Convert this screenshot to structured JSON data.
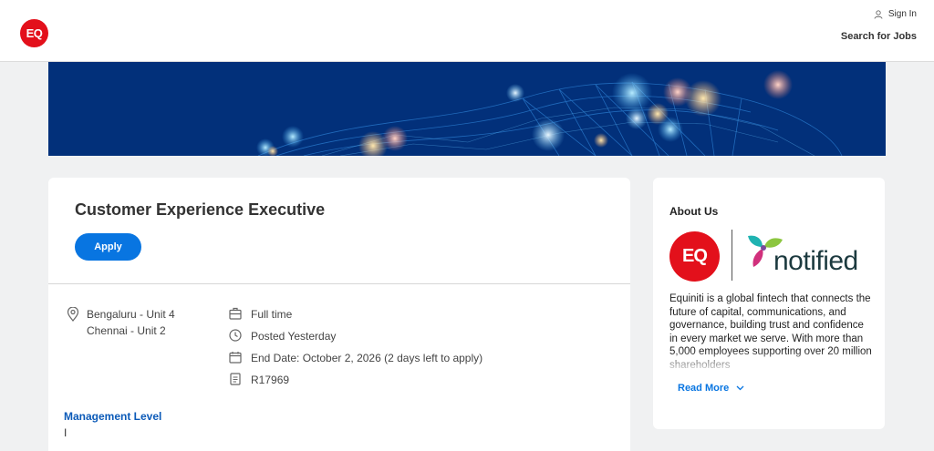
{
  "header": {
    "logo_text": "EQ",
    "sign_in": "Sign In",
    "search_jobs": "Search for Jobs"
  },
  "job": {
    "title": "Customer Experience Executive",
    "apply_label": "Apply",
    "locations": [
      "Bengaluru - Unit 4",
      "Chennai - Unit 2"
    ],
    "time_type": "Full time",
    "posted": "Posted Yesterday",
    "end_date": "End Date: October 2, 2026 (2 days left to apply)",
    "req_id": "R17969",
    "management_level_label": "Management Level",
    "management_level_value": "I"
  },
  "about": {
    "title": "About Us",
    "eq_logo_text": "EQ",
    "notified_logo_text": "notified",
    "text": "Equiniti is a global fintech that connects the future of capital, communications, and governance, building trust and confidence in every market we serve. With more than 5,000 employees supporting over 20 million shareholders",
    "read_more": "Read More"
  },
  "colors": {
    "brand_red": "#e3101b",
    "accent_blue": "#0875e1",
    "hero_blue": "#02307a",
    "link_blue": "#0b5ab8"
  },
  "icons": [
    "user-icon",
    "map-pin-icon",
    "briefcase-icon",
    "clock-icon",
    "calendar-icon",
    "document-icon",
    "chevron-down-icon"
  ]
}
